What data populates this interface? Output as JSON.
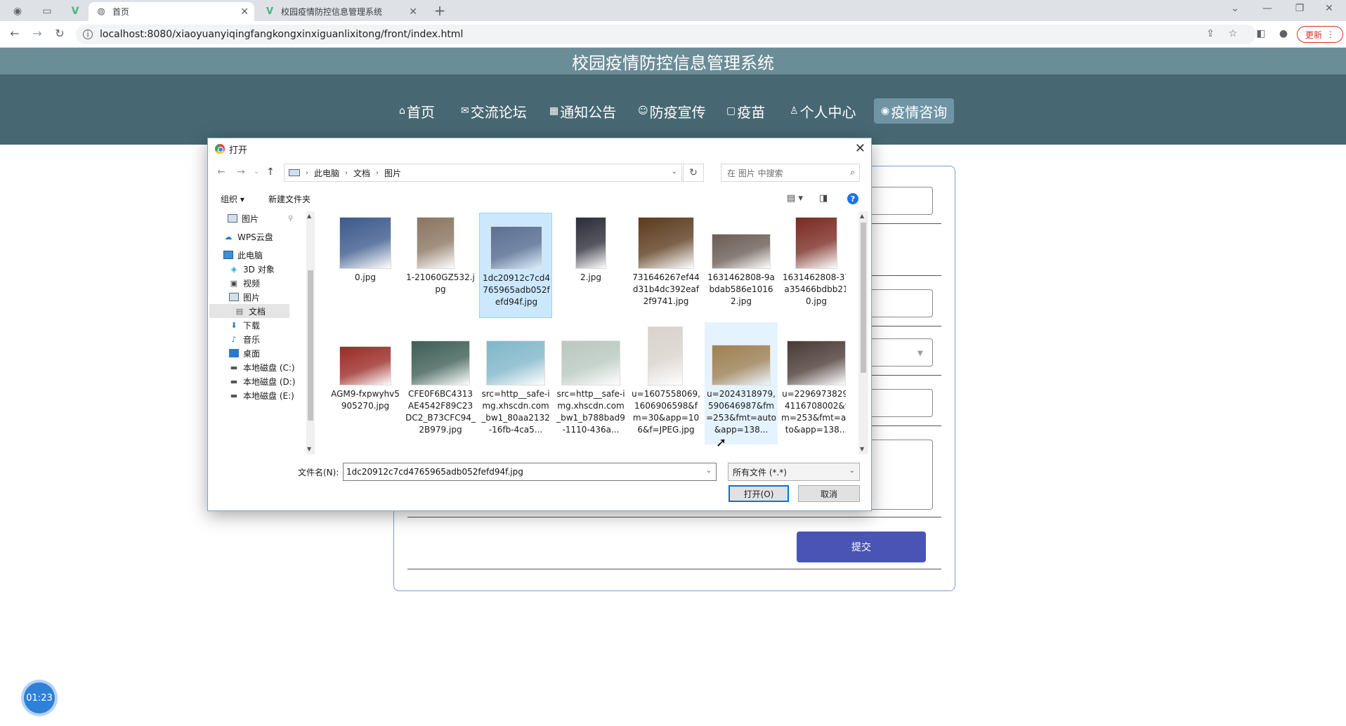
{
  "browser": {
    "tabs": [
      {
        "label": "首页",
        "icon": "globe-icon"
      },
      {
        "label": "校园疫情防控信息管理系统",
        "icon": "vue-icon"
      }
    ],
    "url": "localhost:8080/xiaoyuanyiqingfangkongxinxiguanlixitong/front/index.html",
    "update_label": "更新"
  },
  "site": {
    "title": "校园疫情防控信息管理系统",
    "nav": [
      {
        "label": "首页",
        "icon": "⌂"
      },
      {
        "label": "交流论坛",
        "icon": "✉"
      },
      {
        "label": "通知公告",
        "icon": "▦"
      },
      {
        "label": "防疫宣传",
        "icon": "☺"
      },
      {
        "label": "疫苗",
        "icon": "▢"
      },
      {
        "label": "个人中心",
        "icon": "♙"
      },
      {
        "label": "疫情咨询",
        "icon": "◉"
      }
    ],
    "submit_label": "提交",
    "timer": "01:23"
  },
  "dialog": {
    "title": "打开",
    "breadcrumb": [
      "此电脑",
      "文档",
      "图片"
    ],
    "search_placeholder": "在 图片 中搜索",
    "organize_label": "组织 ▾",
    "new_folder_label": "新建文件夹",
    "tree": [
      {
        "label": "图片",
        "icon": "pictures"
      },
      {
        "label": "WPS云盘",
        "icon": "cloud"
      },
      {
        "label": "此电脑",
        "icon": "pc"
      },
      {
        "label": "3D 对象",
        "icon": "3d"
      },
      {
        "label": "视频",
        "icon": "video"
      },
      {
        "label": "图片",
        "icon": "pictures"
      },
      {
        "label": "文档",
        "icon": "docs"
      },
      {
        "label": "下载",
        "icon": "download"
      },
      {
        "label": "音乐",
        "icon": "music"
      },
      {
        "label": "桌面",
        "icon": "desktop"
      },
      {
        "label": "本地磁盘 (C:)",
        "icon": "disk"
      },
      {
        "label": "本地磁盘 (D:)",
        "icon": "disk"
      },
      {
        "label": "本地磁盘 (E:)",
        "icon": "disk"
      }
    ],
    "files": [
      {
        "name": "0.jpg",
        "color": "#3b5a8c"
      },
      {
        "name": "1-21060GZ532.jpg",
        "color": "#8a7560"
      },
      {
        "name": "1dc20912c7cd4765965adb052fefd94f.jpg",
        "color": "#5d6f8f"
      },
      {
        "name": "2.jpg",
        "color": "#2d2d3a"
      },
      {
        "name": "731646267ef44d31b4dc392eaf2f9741.jpg",
        "color": "#5c3b1d"
      },
      {
        "name": "1631462808-9abdab586e10162.jpg",
        "color": "#6a5d55"
      },
      {
        "name": "1631462808-37a35466bdbb210.jpg",
        "color": "#7a2a22"
      },
      {
        "name": "AGM9-fxpwyhv5905270.jpg",
        "color": "#9b2a26"
      },
      {
        "name": "CFE0F6BC4313AE4542F89C23DC2_B73CFC94_2B979.jpg",
        "color": "#3e5e55"
      },
      {
        "name": "src=http__safe-img.xhscdn.com_bw1_80aa2132-16fb-4ca5...",
        "color": "#7fb6c9"
      },
      {
        "name": "src=http__safe-img.xhscdn.com_bw1_b788bad9-1110-436a...",
        "color": "#b9c8c0"
      },
      {
        "name": "u=1607558069,1606906598&fm=30&app=106&f=JPEG.jpg",
        "color": "#d9d2cc"
      },
      {
        "name": "u=2024318979,590646987&fm=253&fmt=auto&app=138...",
        "color": "#a08052"
      },
      {
        "name": "u=2296973829,4116708002&fm=253&fmt=auto&app=138...",
        "color": "#4a3a36"
      }
    ],
    "filename_label": "文件名(N):",
    "filename_value": "1dc20912c7cd4765965adb052fefd94f.jpg",
    "filetype_value": "所有文件 (*.*)",
    "open_label": "打开(O)",
    "cancel_label": "取消"
  }
}
